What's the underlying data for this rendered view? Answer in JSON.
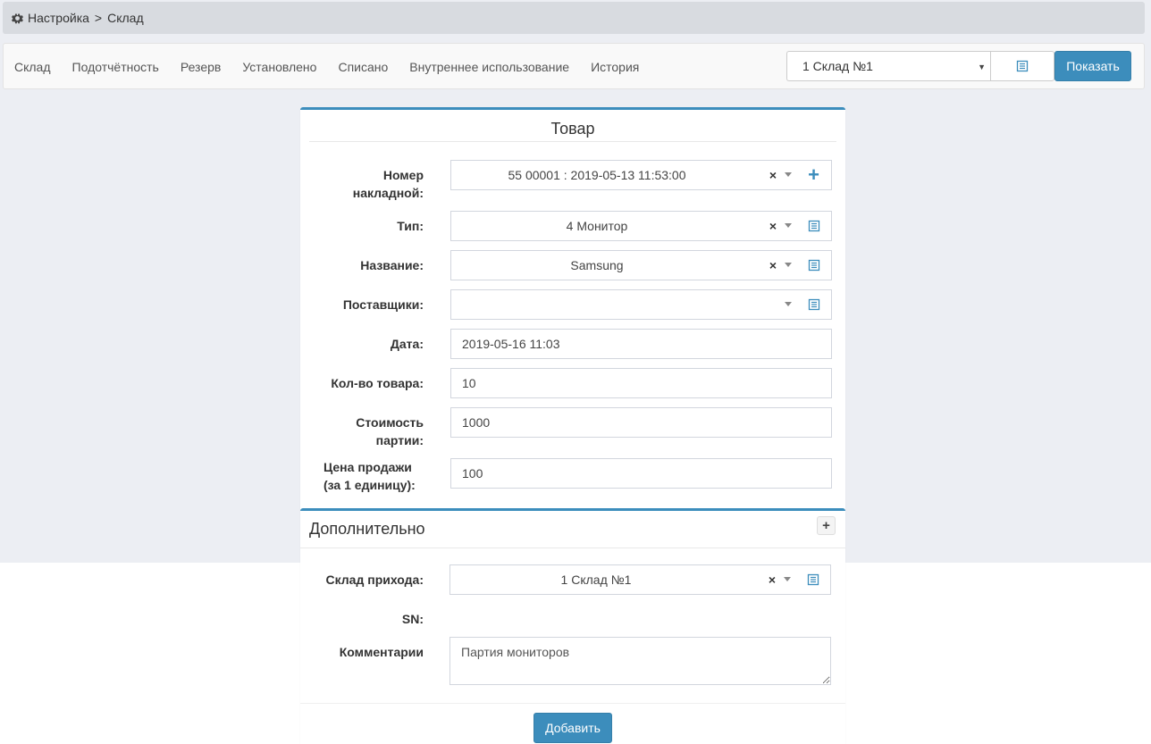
{
  "breadcrumb": {
    "root": "Настройка",
    "separator": ">",
    "current": "Склад"
  },
  "nav": {
    "tabs": [
      "Склад",
      "Подотчётность",
      "Резерв",
      "Установлено",
      "Списано",
      "Внутреннее использование",
      "История"
    ],
    "warehouse_select": "1 Склад №1",
    "show_button": "Показать"
  },
  "product": {
    "title": "Товар",
    "invoice_label": "Номер накладной:",
    "invoice_label_line1": "Номер",
    "invoice_label_line2": "накладной:",
    "invoice_value": "55 00001 : 2019-05-13 11:53:00",
    "type_label": "Тип:",
    "type_value": "4 Монитор",
    "name_label": "Название:",
    "name_value": "Samsung",
    "supplier_label": "Поставщики:",
    "supplier_value": "",
    "date_label": "Дата:",
    "date_value": "2019-05-16 11:03",
    "qty_label": "Кол-во товара:",
    "qty_value": "10",
    "cost_label_line1": "Стоимость",
    "cost_label_line2": "партии:",
    "cost_value": "1000",
    "price_label_line1": "Цена продажи",
    "price_label_line2": "(за 1 единицу):",
    "price_value": "100",
    "clear_symbol": "×"
  },
  "extra": {
    "title": "Дополнительно",
    "toggle": "+",
    "warehouse_label": "Склад прихода:",
    "warehouse_value": "1 Склад №1",
    "sn_label": "SN:",
    "comment_label": "Комментарии",
    "comment_value": "Партия мониторов"
  },
  "actions": {
    "add_button": "Добавить"
  },
  "colors": {
    "accent": "#3c8dbc",
    "page_bg": "#eceef3",
    "breadcrumb_bg": "#d8dbe0"
  }
}
